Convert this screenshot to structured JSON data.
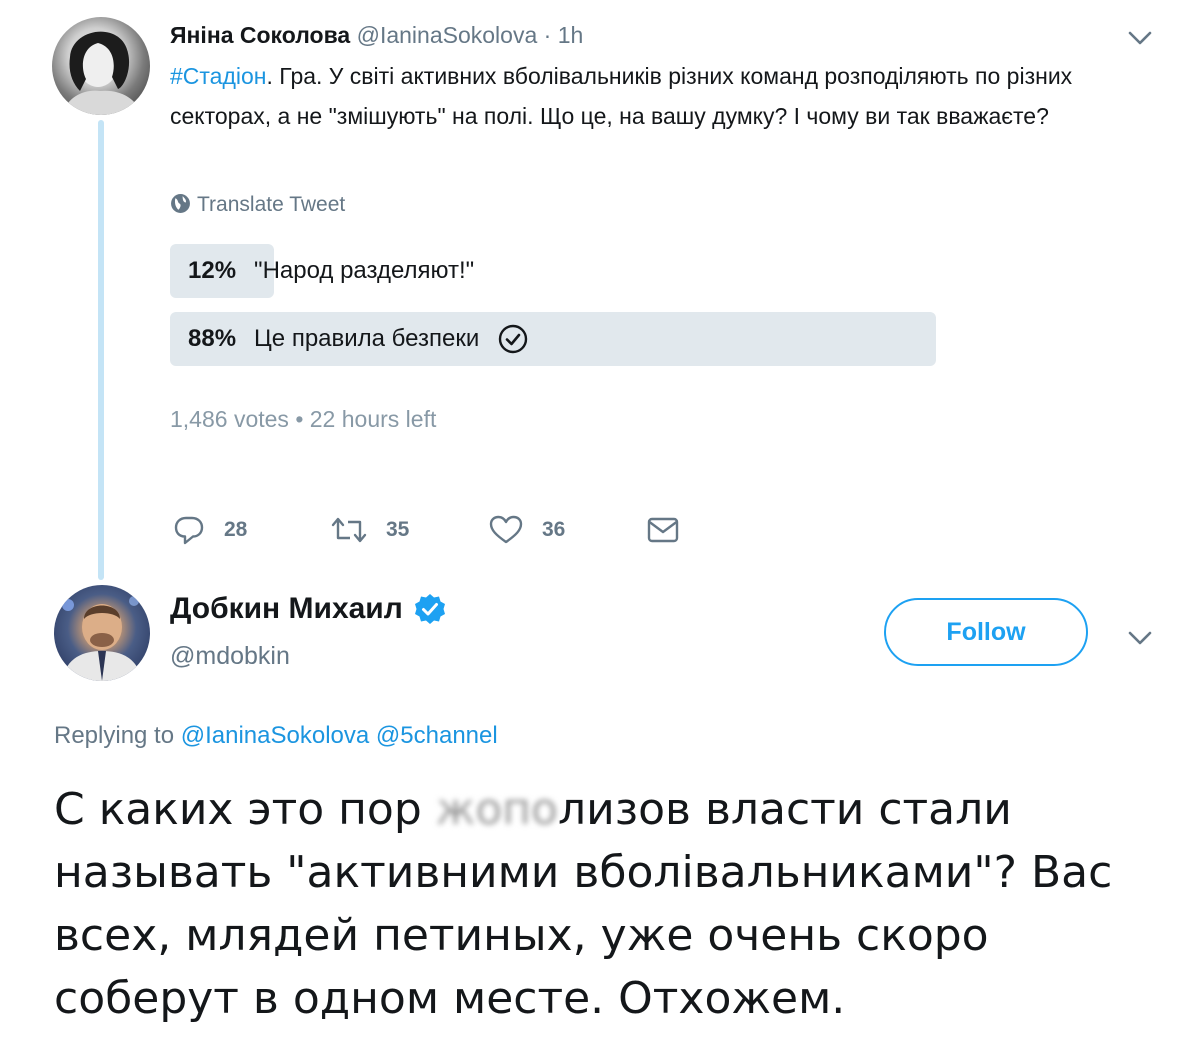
{
  "tweet1": {
    "author_name": "Яніна Соколова",
    "author_handle": "@IaninaSokolova",
    "separator": "·",
    "time": "1h",
    "hashtag": "#Стадіон",
    "text": ". Гра. У світі активних вболівальників різних команд розподіляють по різних секторах, а не \"змішують\" на полі. Що це, на вашу думку? І чому ви так вважаєте?",
    "translate_label": "Translate Tweet",
    "poll": {
      "options": [
        {
          "percent_label": "12%",
          "percent": 12,
          "label": "\"Народ разделяют!\"",
          "selected": false
        },
        {
          "percent_label": "88%",
          "percent": 88,
          "label": "Це правила безпеки",
          "selected": true
        }
      ],
      "votes": "1,486 votes",
      "dot": "•",
      "time_left": "22 hours left"
    },
    "actions": {
      "replies": "28",
      "retweets": "35",
      "likes": "36"
    }
  },
  "tweet2": {
    "author_name": "Добкин Михаил",
    "author_handle": "@mdobkin",
    "verified": true,
    "follow_label": "Follow",
    "replying_to_label": "Replying to",
    "replying_to": [
      "@IaninaSokolova",
      "@5channel"
    ],
    "text_before_censor": "С каких это пор ",
    "censored_text": "жопо",
    "text_after_censor": "лизов власти стали называть \"активними вболівальниками\"? Вас всех, млядей петиных, уже очень скоро соберут в одном месте. Отхожем."
  },
  "colors": {
    "link": "#1b95e0",
    "follow": "#1da1f2",
    "poll_fill": "#e1e8ed",
    "thread_line": "#c4e4f6",
    "muted": "#657786"
  },
  "icons": {
    "header_chevron": "chevron-down-icon",
    "translate": "globe-icon",
    "poll_check": "check-circle-icon",
    "reply": "reply-icon",
    "retweet": "retweet-icon",
    "like": "heart-icon",
    "dm": "envelope-icon",
    "verified": "verified-badge-icon"
  }
}
